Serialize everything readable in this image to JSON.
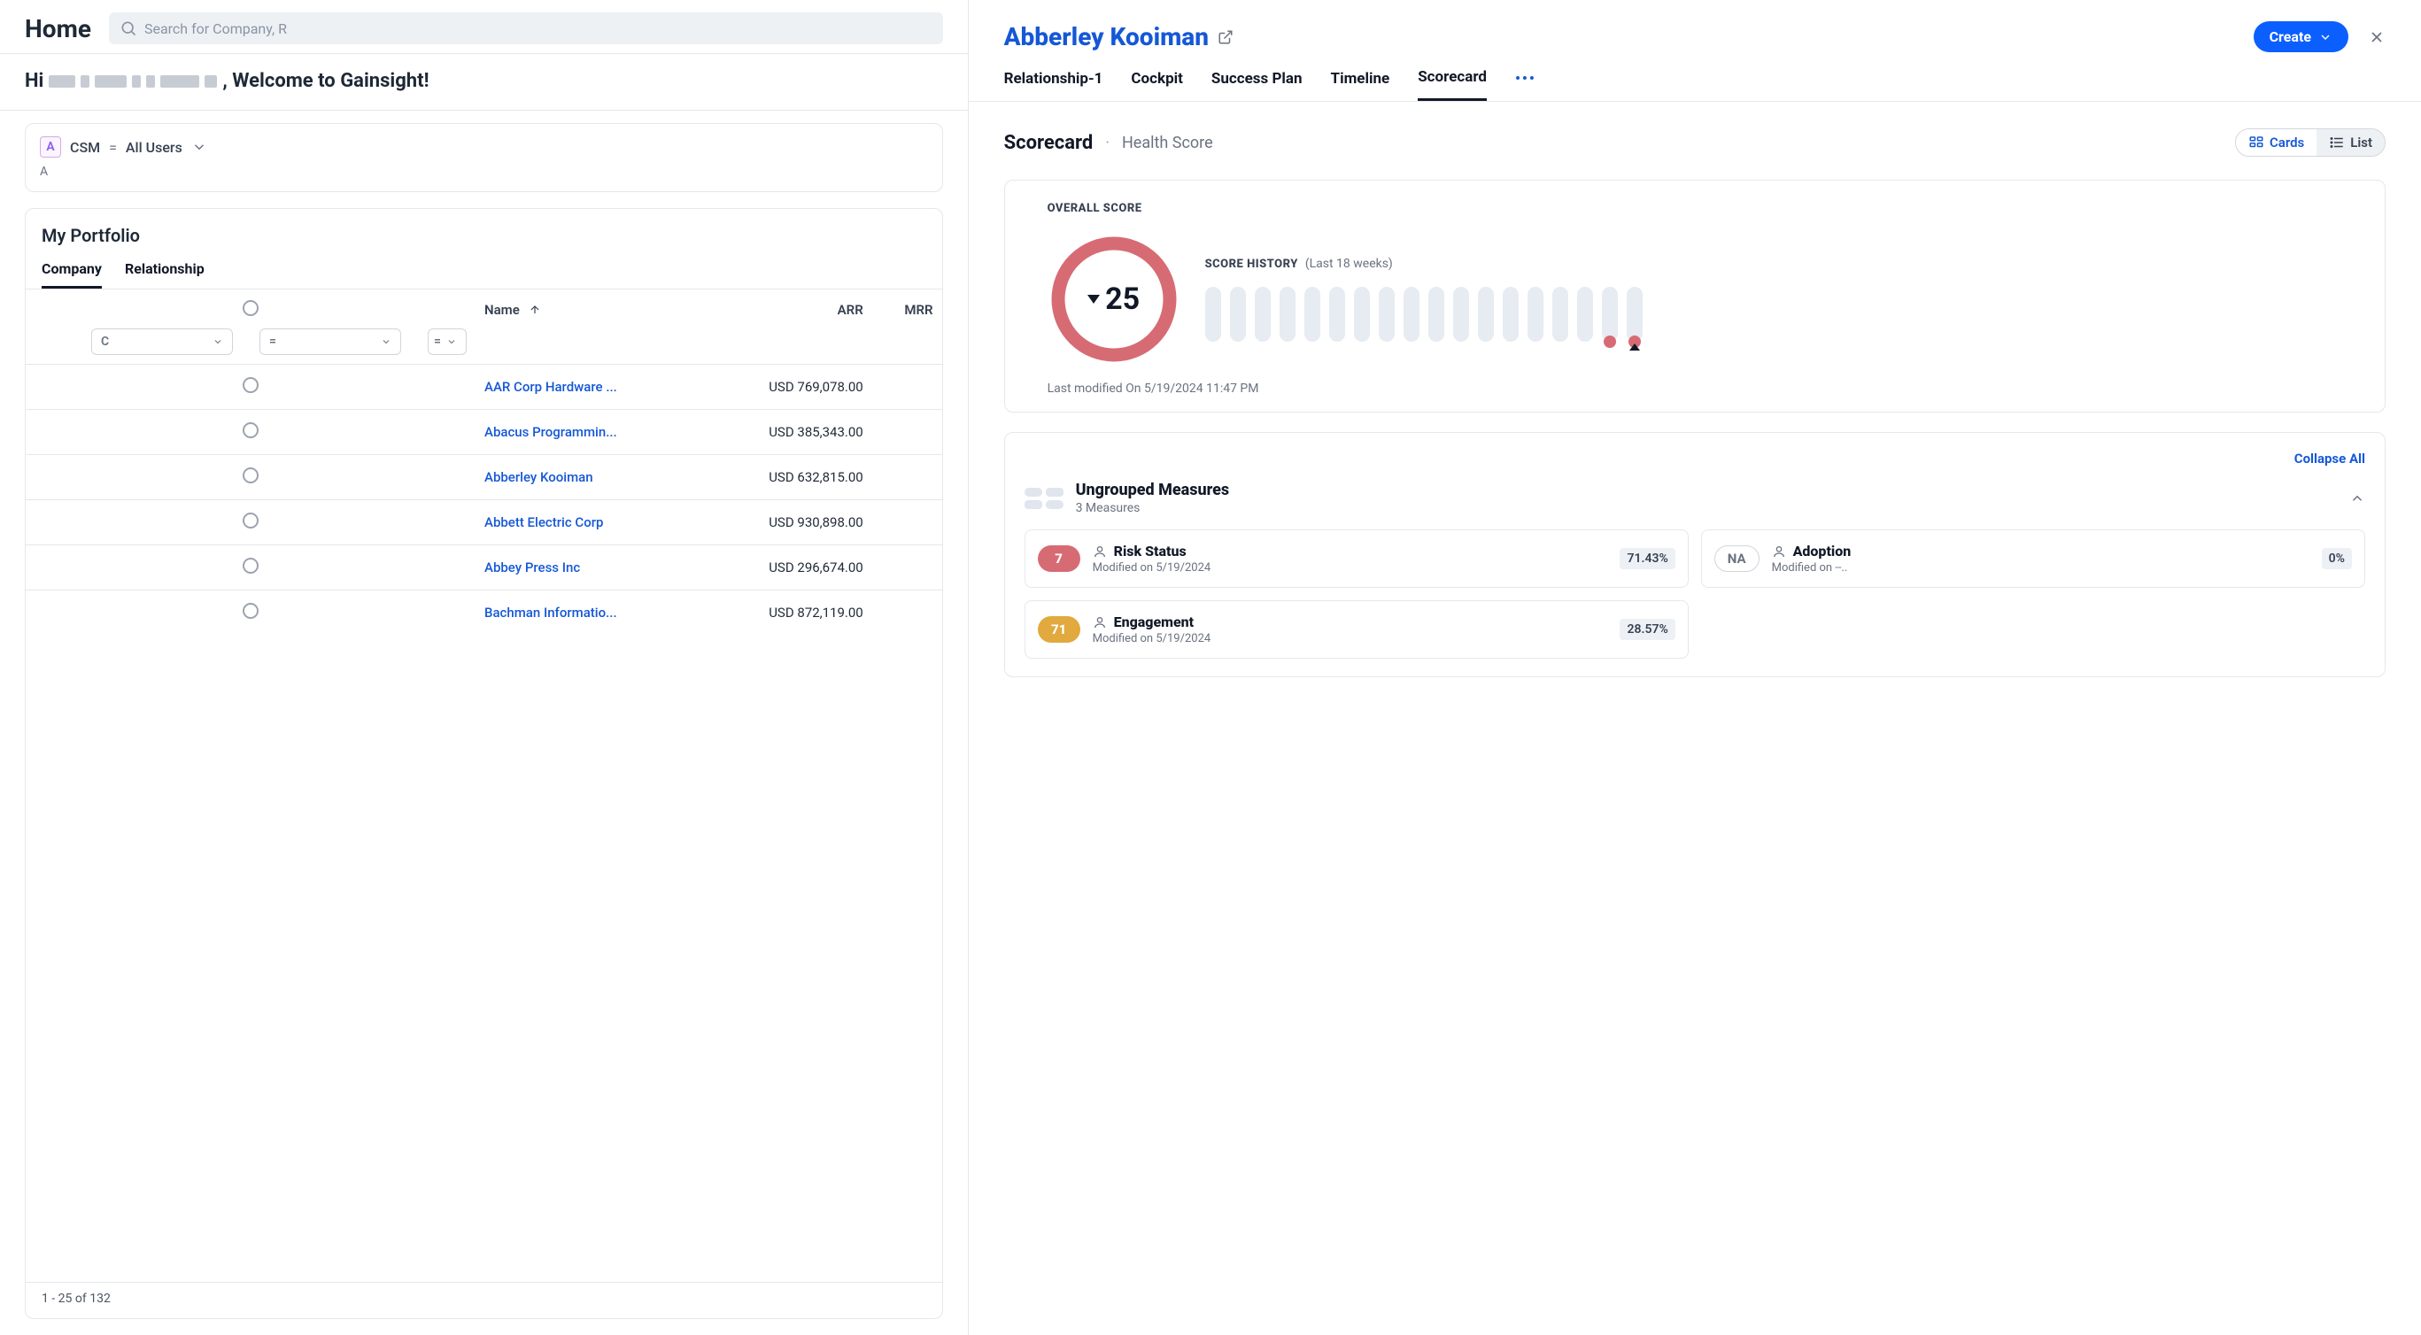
{
  "header": {
    "home_title": "Home",
    "search_placeholder": "Search for Company, R"
  },
  "welcome": {
    "prefix": "Hi",
    "suffix": ", Welcome to Gainsight!"
  },
  "filter": {
    "tag_letter": "A",
    "role": "CSM",
    "all_users": "All Users",
    "subline": "A"
  },
  "portfolio": {
    "title": "My Portfolio",
    "tabs": {
      "company": "Company",
      "relationship": "Relationship"
    },
    "columns": {
      "name": "Name",
      "arr": "ARR",
      "mrr": "MRR"
    },
    "filters": {
      "name_value": "C",
      "arr_value": "=",
      "mrr_value": "="
    },
    "rows": [
      {
        "name": "AAR Corp Hardware ...",
        "arr": "USD 769,078.00"
      },
      {
        "name": "Abacus Programmin...",
        "arr": "USD 385,343.00"
      },
      {
        "name": "Abberley Kooiman",
        "arr": "USD 632,815.00"
      },
      {
        "name": "Abbett Electric Corp",
        "arr": "USD 930,898.00"
      },
      {
        "name": "Abbey Press Inc",
        "arr": "USD 296,674.00"
      },
      {
        "name": "Bachman Informatio...",
        "arr": "USD 872,119.00"
      }
    ],
    "pagination": "1 - 25 of 132"
  },
  "panel": {
    "title": "Abberley Kooiman",
    "create_label": "Create",
    "tabs": [
      "Relationship-1",
      "Cockpit",
      "Success Plan",
      "Timeline",
      "Scorecard"
    ],
    "active_tab": "Scorecard"
  },
  "scorecard": {
    "path_primary": "Scorecard",
    "path_secondary": "Health Score",
    "view_cards": "Cards",
    "view_list": "List",
    "overall_label": "OVERALL SCORE",
    "overall_value": "25",
    "history_label": "SCORE HISTORY",
    "history_range": "(Last 18 weeks)",
    "history_bars_count": 18,
    "history_last_two_active": true,
    "last_modified": "Last modified On 5/19/2024 11:47 PM",
    "collapse_all": "Collapse All",
    "group": {
      "title": "Ungrouped Measures",
      "subtitle": "3 Measures"
    },
    "measures": [
      {
        "score": "7",
        "score_class": "red",
        "name": "Risk Status",
        "modified": "Modified on  5/19/2024",
        "pct": "71.43%"
      },
      {
        "score": "NA",
        "score_class": "na",
        "name": "Adoption",
        "modified": "Modified on  --..",
        "pct": "0%"
      },
      {
        "score": "71",
        "score_class": "amber",
        "name": "Engagement",
        "modified": "Modified on  5/19/2024",
        "pct": "28.57%"
      }
    ]
  },
  "colors": {
    "brand_blue": "#1558d6",
    "button_blue": "#0b5fff",
    "red": "#d76b74",
    "amber": "#e1a93e",
    "bar_bg": "#e7ebf2"
  },
  "chart_data": {
    "type": "bar",
    "title": "SCORE HISTORY",
    "subtitle": "(Last 18 weeks)",
    "x": [
      1,
      2,
      3,
      4,
      5,
      6,
      7,
      8,
      9,
      10,
      11,
      12,
      13,
      14,
      15,
      16,
      17,
      18
    ],
    "series": [
      {
        "name": "Health Score",
        "values": [
          null,
          null,
          null,
          null,
          null,
          null,
          null,
          null,
          null,
          null,
          null,
          null,
          null,
          null,
          null,
          null,
          25,
          25
        ]
      }
    ],
    "ylim": [
      0,
      100
    ],
    "note": "Weeks 1–16 have no recorded score; weeks 17–18 ≈ 25 (red)."
  }
}
